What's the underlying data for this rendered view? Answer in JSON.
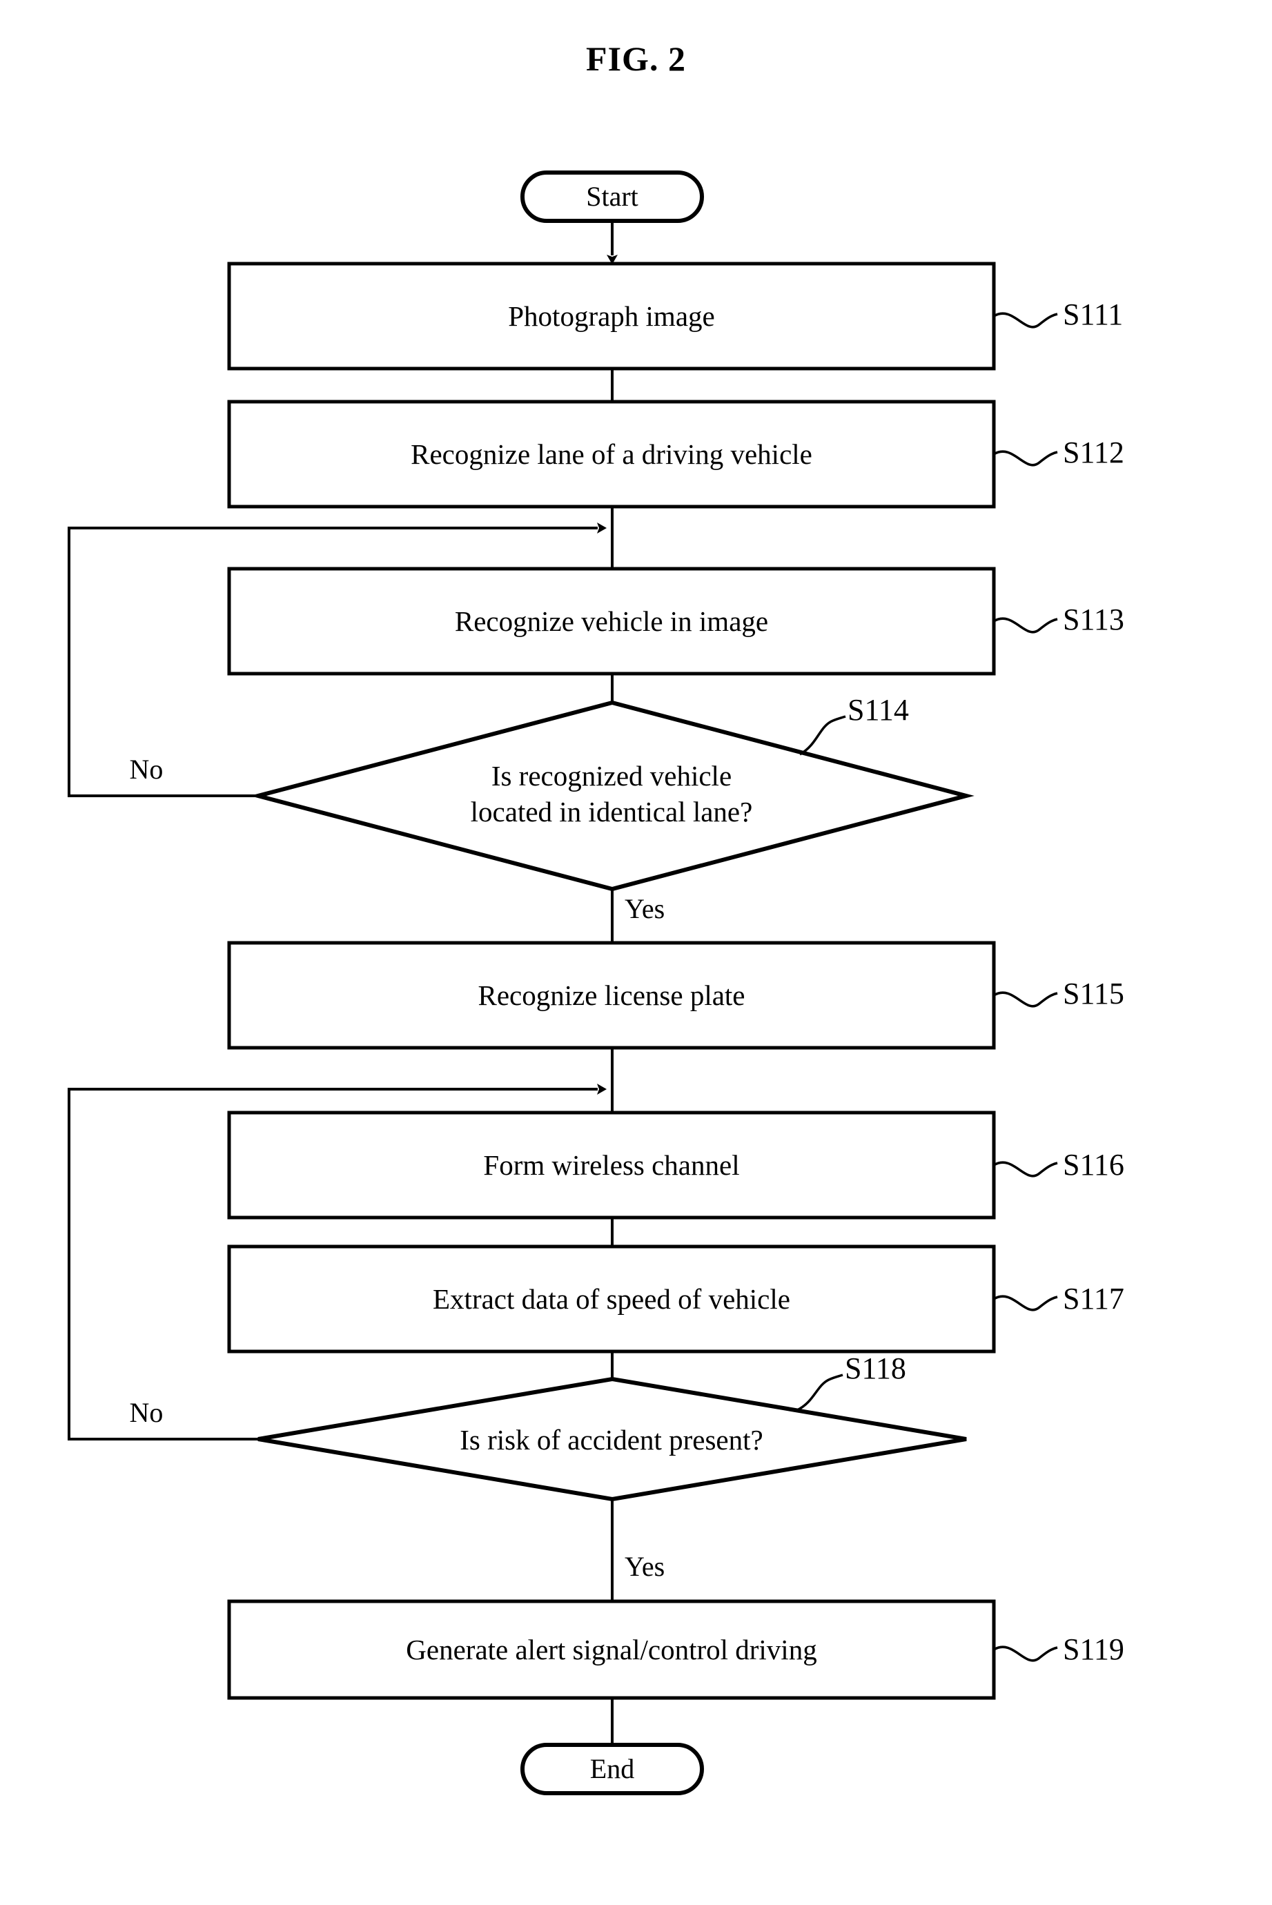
{
  "figure": {
    "title": "FIG. 2",
    "type": "flowchart"
  },
  "terminators": {
    "start": "Start",
    "end": "End"
  },
  "branch_labels": {
    "no": "No",
    "yes": "Yes"
  },
  "steps": [
    {
      "id": "S111",
      "shape": "process",
      "text": "Photograph image",
      "tag": "S111"
    },
    {
      "id": "S112",
      "shape": "process",
      "text": "Recognize lane of a driving vehicle",
      "tag": "S112"
    },
    {
      "id": "S113",
      "shape": "process",
      "text": "Recognize vehicle in image",
      "tag": "S113"
    },
    {
      "id": "S114",
      "shape": "decision",
      "text_line1": "Is recognized vehicle",
      "text_line2": "located in identical lane?",
      "tag": "S114"
    },
    {
      "id": "S115",
      "shape": "process",
      "text": "Recognize license plate",
      "tag": "S115"
    },
    {
      "id": "S116",
      "shape": "process",
      "text": "Form wireless channel",
      "tag": "S116"
    },
    {
      "id": "S117",
      "shape": "process",
      "text": "Extract data of speed of vehicle",
      "tag": "S117"
    },
    {
      "id": "S118",
      "shape": "decision",
      "text": "Is risk of accident present?",
      "tag": "S118"
    },
    {
      "id": "S119",
      "shape": "process",
      "text": "Generate alert signal/control driving",
      "tag": "S119"
    }
  ],
  "edges": {
    "s114_no": "No",
    "s114_yes": "Yes",
    "s118_no": "No",
    "s118_yes": "Yes"
  },
  "colors": {
    "ink": "#000000",
    "paper": "#ffffff"
  }
}
